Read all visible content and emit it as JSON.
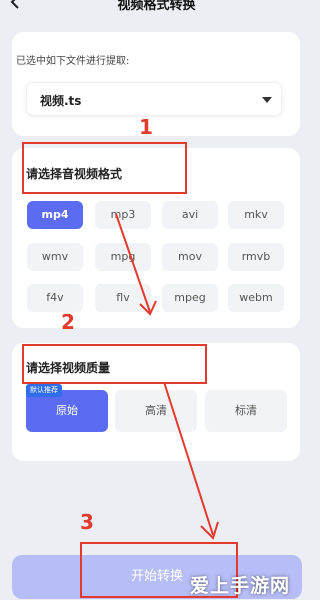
{
  "header": {
    "title": "视频格式转换"
  },
  "selection": {
    "label": "已选中如下文件进行提取:",
    "file": "视频.ts"
  },
  "format": {
    "label": "请选择音视频格式",
    "options": [
      "mp4",
      "mp3",
      "avi",
      "mkv",
      "wmv",
      "mpg",
      "mov",
      "rmvb",
      "f4v",
      "flv",
      "mpeg",
      "webm"
    ],
    "selected": "mp4"
  },
  "quality": {
    "label": "请选择视频质量",
    "badge": "默认推荐",
    "options": [
      "原始",
      "高清",
      "标清"
    ],
    "selected": "原始"
  },
  "action": {
    "start": "开始转换"
  },
  "annotations": {
    "n1": "1",
    "n2": "2",
    "n3": "3",
    "color": "#e23a2e"
  },
  "watermark": "爱上手游网",
  "colors": {
    "accent": "#5b6cf2",
    "background": "#eceef3",
    "button_disabled": "#b6bdf7"
  }
}
